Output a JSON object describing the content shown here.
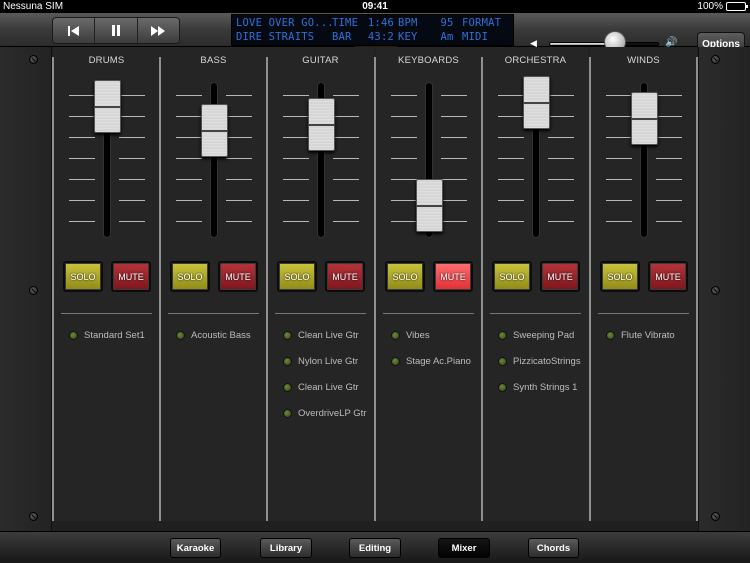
{
  "status": {
    "carrier": "Nessuna SIM",
    "time": "09:41",
    "battery": "100%"
  },
  "transport": {
    "prev_icon": "skip-back-icon",
    "pause_icon": "pause-icon",
    "next_icon": "skip-forward-icon"
  },
  "lcd": {
    "row1": {
      "title": "LOVE OVER GO...",
      "time_label": "TIME",
      "time": "1:46",
      "bpm_label": "BPM",
      "bpm": "95",
      "format_label": "FORMAT"
    },
    "row2": {
      "artist": "DIRE STRAITS",
      "bar_label": "BAR",
      "bar": "43:2",
      "key_label": "KEY",
      "key": "Am",
      "format": "MIDI"
    }
  },
  "volume": {
    "level": 0.6
  },
  "options_label": "Options",
  "channels": [
    {
      "name": "DRUMS",
      "level": 0.95,
      "solo": "SOLO",
      "mute": "MUTE",
      "mute_active": false,
      "instruments": [
        "Standard Set1"
      ]
    },
    {
      "name": "BASS",
      "level": 0.75,
      "solo": "SOLO",
      "mute": "MUTE",
      "mute_active": false,
      "instruments": [
        "Acoustic Bass"
      ]
    },
    {
      "name": "GUITAR",
      "level": 0.8,
      "solo": "SOLO",
      "mute": "MUTE",
      "mute_active": false,
      "instruments": [
        "Clean Live Gtr",
        "Nylon Live Gtr",
        "Clean Live Gtr",
        "OverdriveLP Gtr"
      ]
    },
    {
      "name": "KEYBOARDS",
      "level": 0.12,
      "solo": "SOLO",
      "mute": "MUTE",
      "mute_active": true,
      "instruments": [
        "Vibes",
        "Stage Ac.Piano"
      ]
    },
    {
      "name": "ORCHESTRA",
      "level": 0.98,
      "solo": "SOLO",
      "mute": "MUTE",
      "mute_active": false,
      "instruments": [
        "Sweeping Pad",
        "PizzicatoStrings",
        "Synth Strings 1"
      ]
    },
    {
      "name": "WINDS",
      "level": 0.85,
      "solo": "SOLO",
      "mute": "MUTE",
      "mute_active": false,
      "instruments": [
        "Flute Vibrato"
      ]
    }
  ],
  "tabs": [
    {
      "label": "Karaoke",
      "active": false
    },
    {
      "label": "Library",
      "active": false
    },
    {
      "label": "Editing",
      "active": false
    },
    {
      "label": "Mixer",
      "active": true
    },
    {
      "label": "Chords",
      "active": false
    }
  ],
  "colors": {
    "lcd_text": "#2f72d8",
    "solo": "#c9c43b",
    "mute": "#b6343c",
    "mute_active": "#e02e36"
  }
}
